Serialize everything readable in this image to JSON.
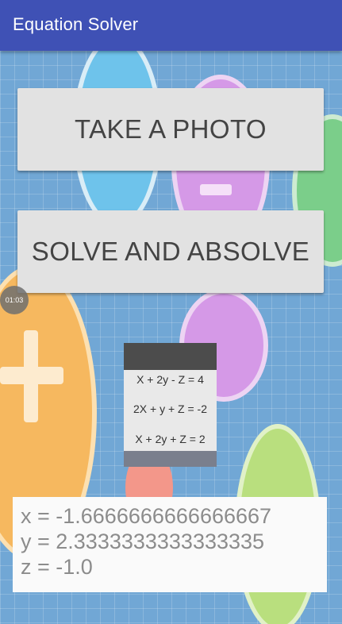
{
  "app": {
    "title": "Equation Solver"
  },
  "buttons": {
    "take_photo": "TAKE A PHOTO",
    "solve": "SOLVE AND ABSOLVE"
  },
  "timer": "01:03",
  "photo": {
    "equations": [
      "X + 2y - Z = 4",
      "2X + y + Z = -2",
      "X + 2y + Z = 2"
    ]
  },
  "results": {
    "x": "x = -1.6666666666666667",
    "y": "y = 2.3333333333333335",
    "z": "z = -1.0"
  },
  "colors": {
    "app_bar": "#3f51b5",
    "background": "#4a8fc9",
    "button": "#e2e2e2"
  }
}
